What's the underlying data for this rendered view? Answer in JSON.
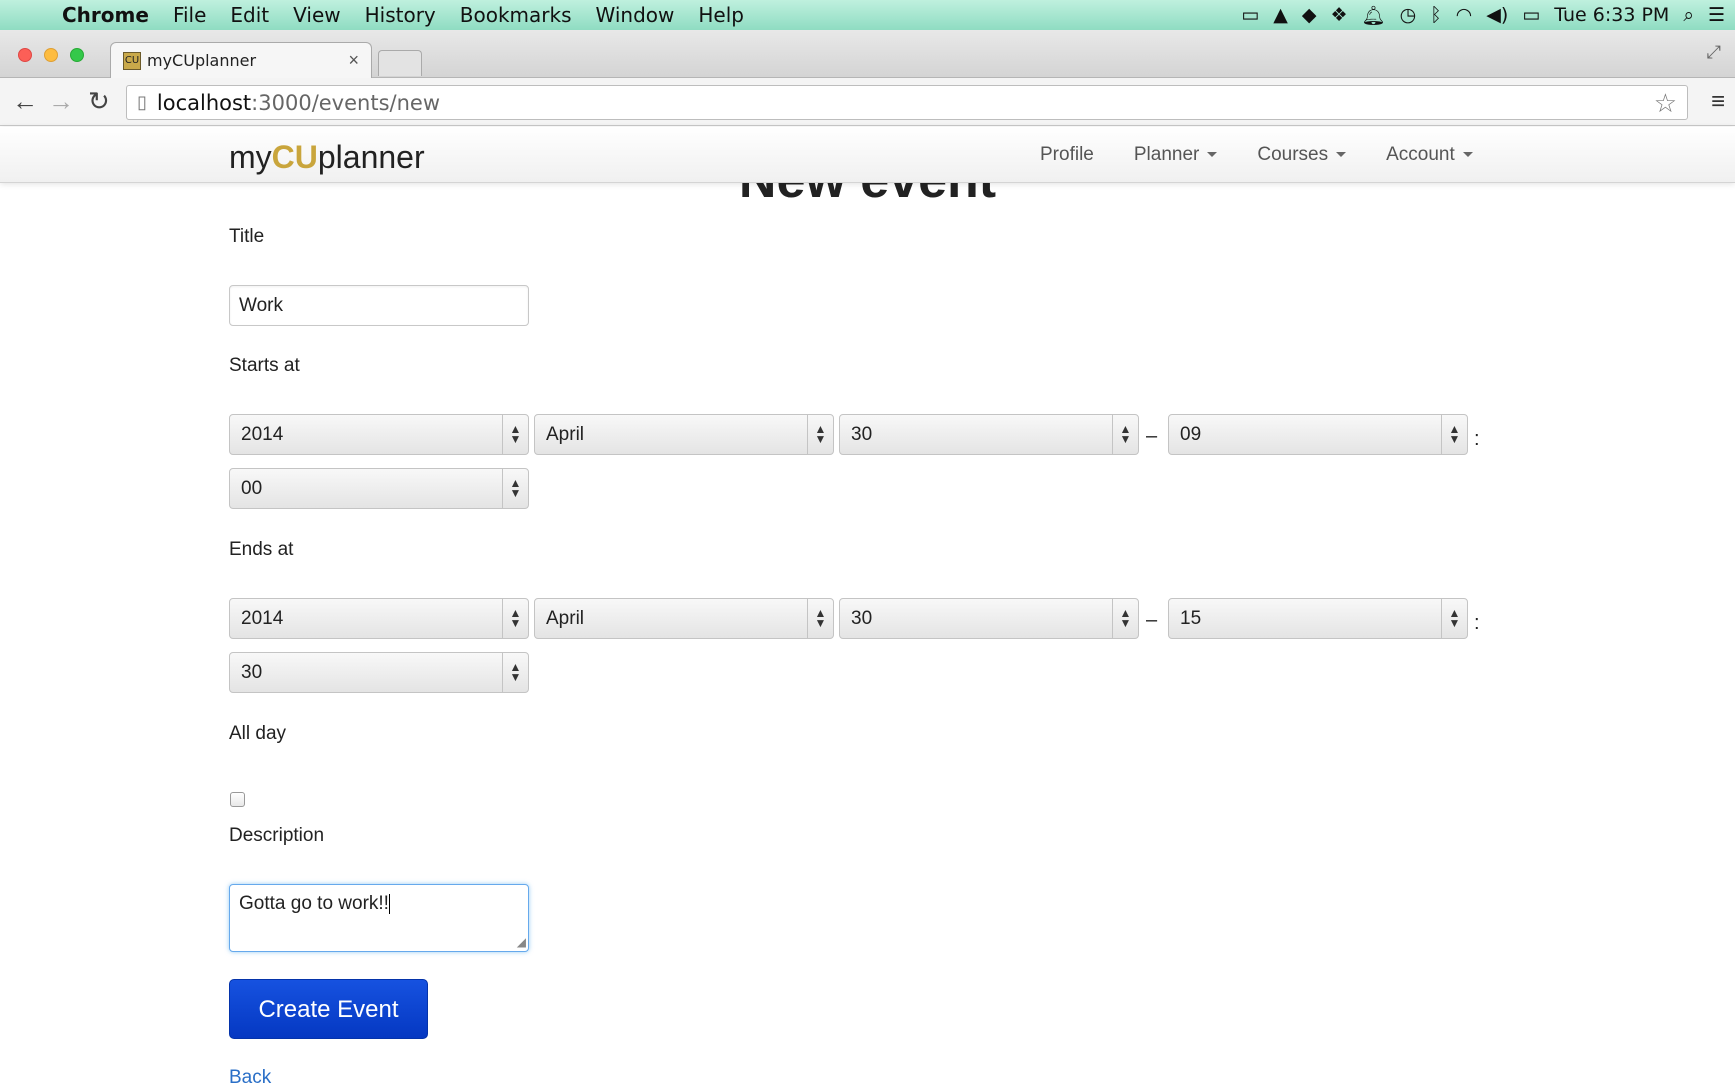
{
  "menubar": {
    "apple": "",
    "items": [
      "Chrome",
      "File",
      "Edit",
      "View",
      "History",
      "Bookmarks",
      "Window",
      "Help"
    ],
    "clock": "Tue 6:33 PM"
  },
  "tab": {
    "title": "myCUplanner",
    "close": "×"
  },
  "omnibox": {
    "host": "localhost",
    "path": ":3000/events/new"
  },
  "navbar": {
    "brand_pre": "my",
    "brand_cu": "CU",
    "brand_post": "planner",
    "links": [
      "Profile",
      "Planner",
      "Courses",
      "Account"
    ]
  },
  "page": {
    "heading": "New event"
  },
  "form": {
    "title_label": "Title",
    "title_value": "Work",
    "starts_label": "Starts at",
    "starts": {
      "year": "2014",
      "month": "April",
      "day": "30",
      "hour": "09",
      "minute": "00"
    },
    "ends_label": "Ends at",
    "ends": {
      "year": "2014",
      "month": "April",
      "day": "30",
      "hour": "15",
      "minute": "30"
    },
    "allday_label": "All day",
    "allday_checked": false,
    "description_label": "Description",
    "description_value": "Gotta go to work!!",
    "submit_label": "Create Event",
    "back_label": "Back",
    "dash": "–",
    "colon": ":"
  }
}
